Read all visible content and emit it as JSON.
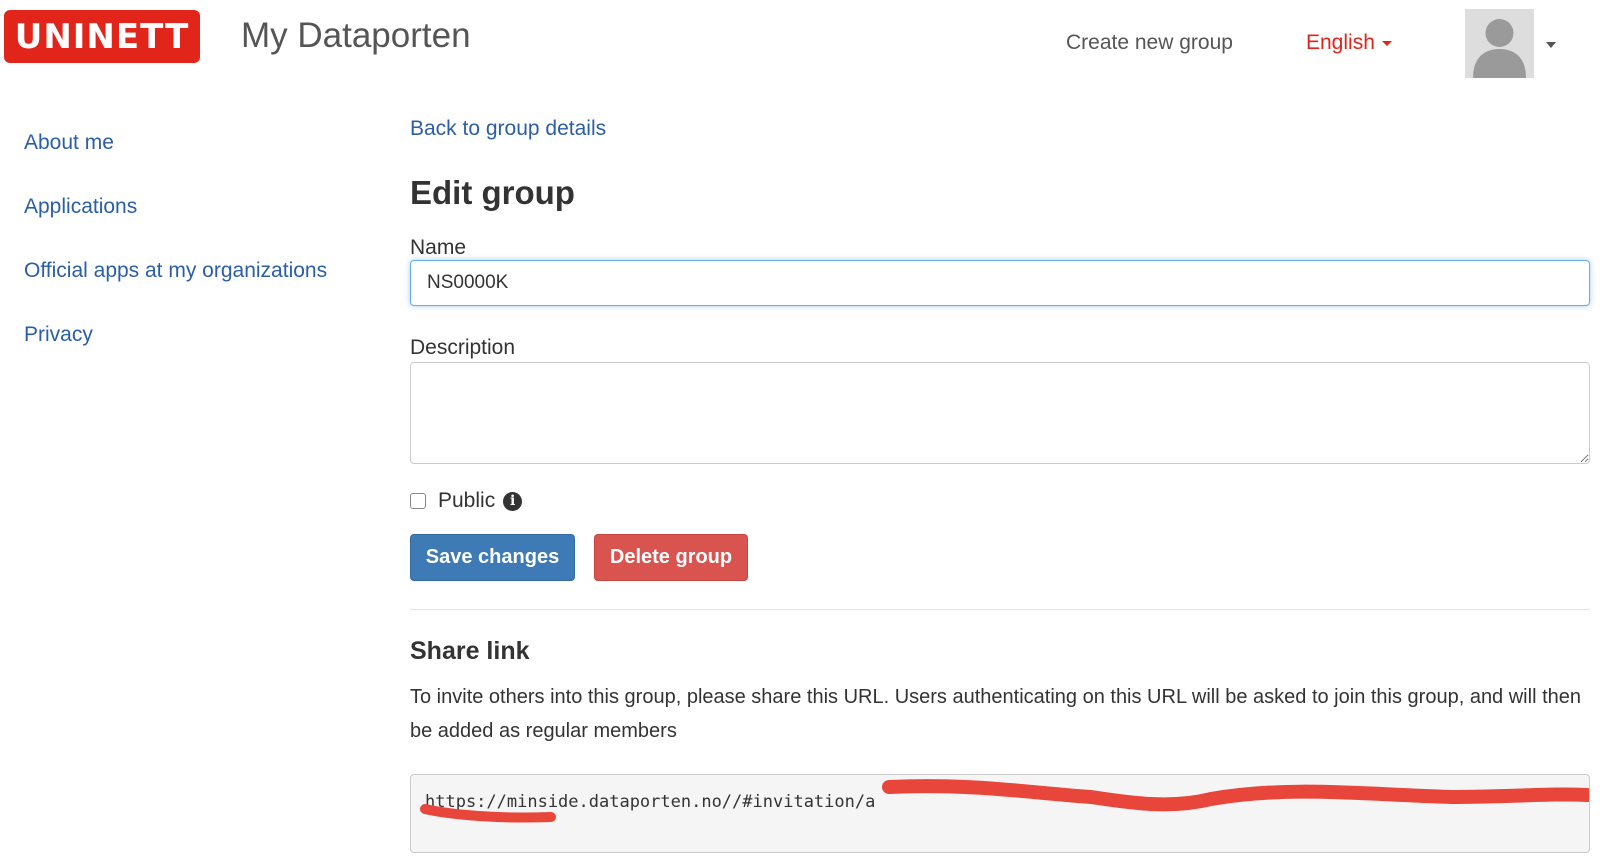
{
  "header": {
    "logo_text": "UNINETT",
    "app_title": "My Dataporten",
    "create_group_label": "Create new group",
    "language_label": "English",
    "avatar_icon": "user-silhouette-icon"
  },
  "sidebar": {
    "items": [
      {
        "label": "About me"
      },
      {
        "label": "Applications"
      },
      {
        "label": "Official apps at my organizations"
      },
      {
        "label": "Privacy"
      }
    ]
  },
  "main": {
    "back_link": "Back to group details",
    "title": "Edit group",
    "name_label": "Name",
    "name_value": "NS0000K",
    "description_label": "Description",
    "description_value": "",
    "public_label": "Public",
    "public_checked": false,
    "save_button": "Save changes",
    "delete_button": "Delete group"
  },
  "share": {
    "title": "Share link",
    "description": "To invite others into this group, please share this URL. Users authenticating on this URL will be asked to join this group, and will then be added as regular members",
    "url_visible": "https://minside.dataporten.no//#invitation/a"
  },
  "colors": {
    "brand_red": "#e1251b",
    "link_blue": "#2b5ea7",
    "save_blue": "#3d7ab6",
    "delete_red": "#d9534f",
    "redaction_red": "#e8463a"
  }
}
